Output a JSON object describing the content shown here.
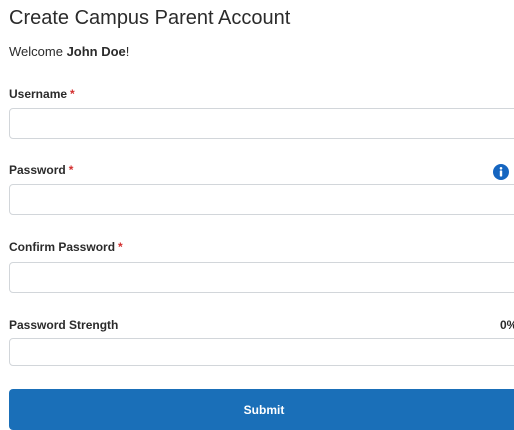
{
  "page": {
    "title": "Create Campus Parent Account",
    "welcome_prefix": "Welcome ",
    "user_name": "John Doe",
    "welcome_suffix": "!"
  },
  "form": {
    "username": {
      "label": "Username",
      "required_mark": "*",
      "value": "",
      "placeholder": ""
    },
    "password": {
      "label": "Password",
      "required_mark": "*",
      "value": "",
      "placeholder": "",
      "info_icon": "info-circle-icon"
    },
    "confirm_password": {
      "label": "Confirm Password",
      "required_mark": "*",
      "value": "",
      "placeholder": ""
    },
    "password_strength": {
      "label": "Password Strength",
      "percent_text": "0%",
      "level": 0
    },
    "submit_label": "Submit"
  },
  "colors": {
    "accent": "#1a6fb8",
    "required": "#d32f2f",
    "info": "#1565c0"
  }
}
